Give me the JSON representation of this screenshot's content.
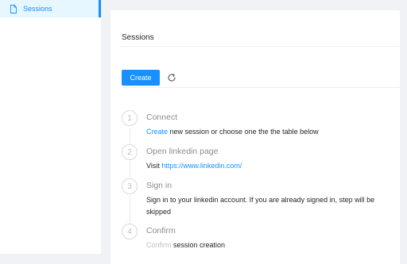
{
  "sidebar": {
    "items": [
      {
        "label": "Sessions",
        "icon": "file-icon"
      }
    ]
  },
  "card": {
    "title": "Sessions",
    "create_label": "Create",
    "reload_icon": "reload-icon"
  },
  "steps": [
    {
      "number": "1",
      "title": "Connect",
      "desc_link": "Create",
      "desc_text": " new session or choose one the the table below"
    },
    {
      "number": "2",
      "title": "Open linkedin page",
      "desc_text": "Visit ",
      "desc_link": "https://www.linkedin.com/"
    },
    {
      "number": "3",
      "title": "Sign in",
      "desc_text": "Sign in to your linkedin account. If you are already signed in, step will be skipped"
    },
    {
      "number": "4",
      "title": "Confirm",
      "desc_link": "Confirm",
      "desc_text": " session creation"
    }
  ],
  "colors": {
    "accent": "#1890ff",
    "background": "#f0f2f5",
    "muted": "#bfbfbf"
  }
}
